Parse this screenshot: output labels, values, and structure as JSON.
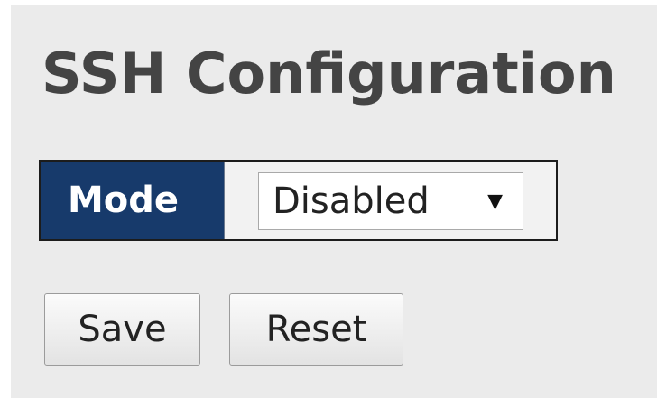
{
  "page": {
    "title": "SSH Configuration"
  },
  "settings": {
    "mode_label": "Mode",
    "mode_selected": "Disabled",
    "mode_options": [
      "Disabled"
    ]
  },
  "actions": {
    "save_label": "Save",
    "reset_label": "Reset"
  },
  "colors": {
    "panel_background": "#ebebeb",
    "label_background": "#173a6b",
    "label_text": "#ffffff",
    "title_text": "#444444"
  },
  "icons": {
    "dropdown": "dropdown-arrow-icon"
  }
}
